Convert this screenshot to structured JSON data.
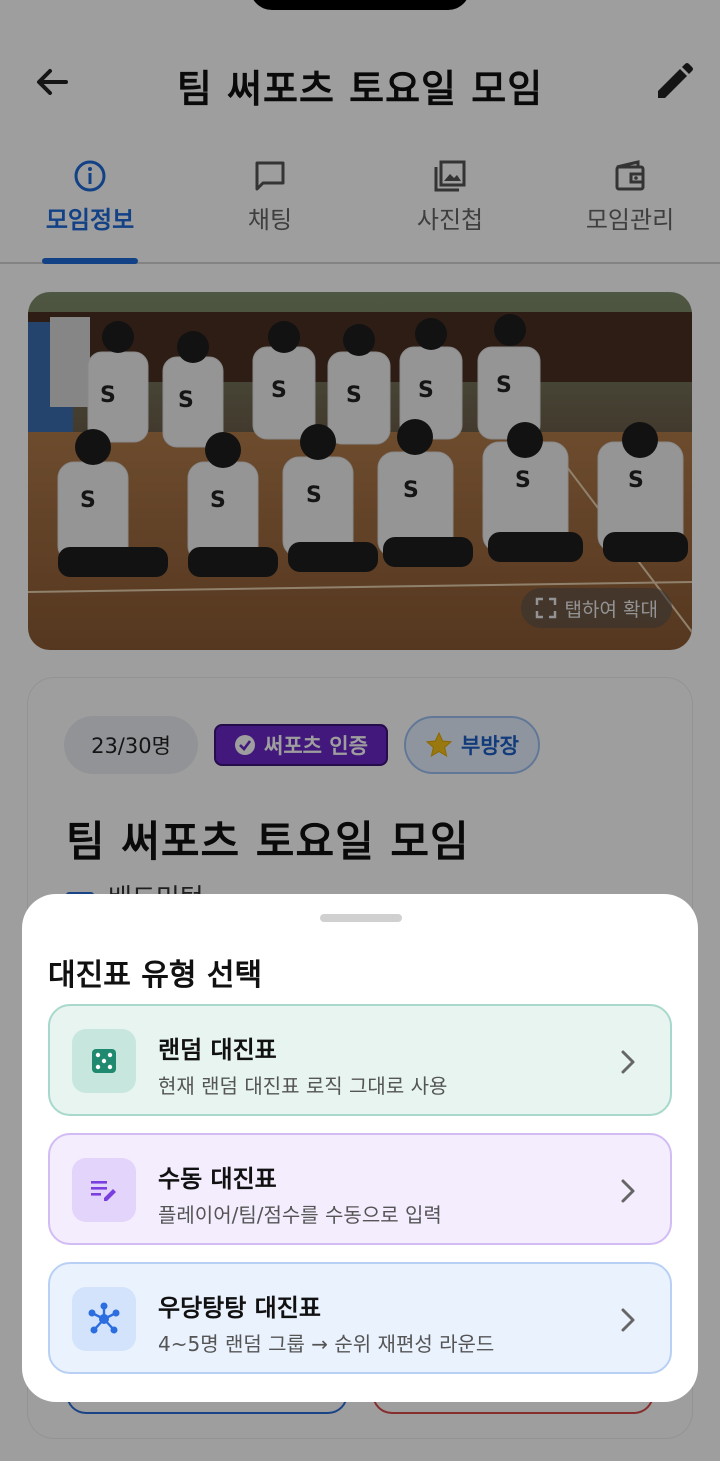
{
  "header": {
    "title": "팀 써포츠 토요일 모임"
  },
  "tabs": [
    {
      "label": "모임정보",
      "icon": "info-icon",
      "active": true
    },
    {
      "label": "채팅",
      "icon": "chat-icon",
      "active": false
    },
    {
      "label": "사진첩",
      "icon": "gallery-icon",
      "active": false
    },
    {
      "label": "모임관리",
      "icon": "wallet-icon",
      "active": false
    }
  ],
  "photo": {
    "zoom_hint": "탭하여 확대"
  },
  "info_card": {
    "member_count": "23/30명",
    "verified_badge": "써포츠 인증",
    "role_badge": "부방장",
    "title": "팀 써포츠 토요일 모임",
    "category": "배드민턴"
  },
  "sheet": {
    "title": "대진표 유형 선택",
    "options": [
      {
        "title": "랜덤 대진표",
        "desc": "현재 랜덤 대진표 로직 그대로 사용",
        "icon": "dice-icon",
        "accent": "#1f8a70"
      },
      {
        "title": "수동 대진표",
        "desc": "플레이어/팀/점수를 수동으로 입력",
        "icon": "edit-list-icon",
        "accent": "#7b3fe0"
      },
      {
        "title": "우당탕탕 대진표",
        "desc": "4~5명 랜덤 그룹 → 순위 재편성 라운드",
        "icon": "network-icon",
        "accent": "#2c6ee0"
      }
    ]
  },
  "colors": {
    "primary": "#1e6ad8",
    "verified": "#6b28c8"
  }
}
